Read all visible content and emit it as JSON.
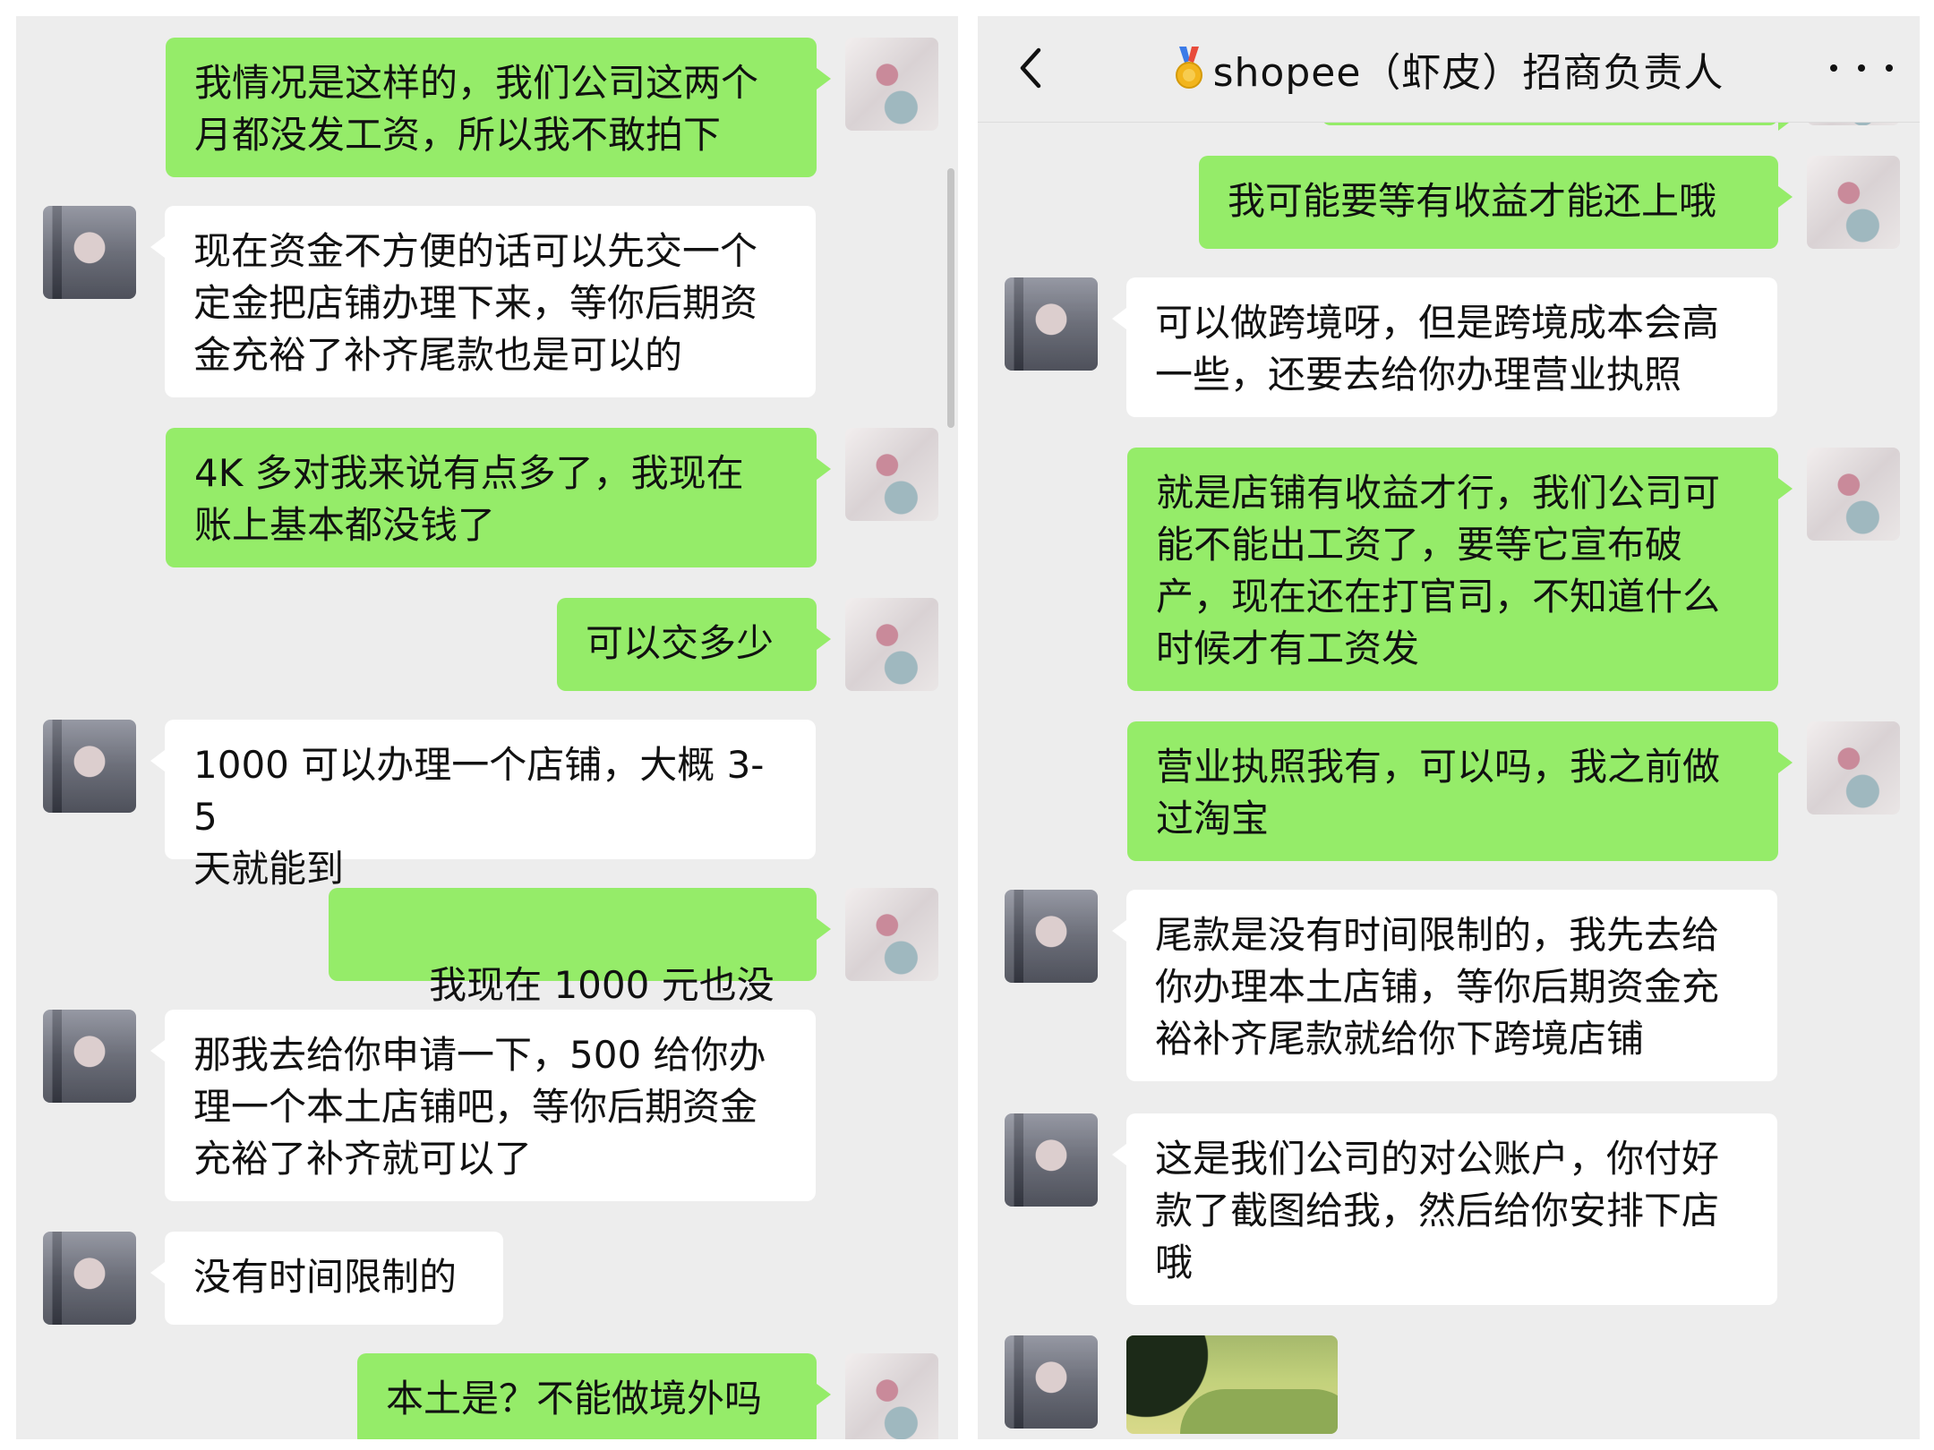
{
  "left_chat": {
    "messages": [
      {
        "side": "out",
        "text": "我情况是这样的，我们公司这两个\n月都没发工资，所以我不敢拍下"
      },
      {
        "side": "in",
        "text": "现在资金不方便的话可以先交一个\n定金把店铺办理下来，等你后期资\n金充裕了补齐尾款也是可以的"
      },
      {
        "side": "out",
        "text": "4K 多对我来说有点多了，我现在\n账上基本都没钱了"
      },
      {
        "side": "out",
        "text": "可以交多少"
      },
      {
        "side": "in",
        "text": "1000 可以办理一个店铺，大概 3-5\n天就能到"
      },
      {
        "side": "out",
        "text": "我现在 1000 元也没有",
        "emoji": "😭"
      },
      {
        "side": "in",
        "text": "那我去给你申请一下，500 给你办\n理一个本土店铺吧，等你后期资金\n充裕了补齐就可以了"
      },
      {
        "side": "in",
        "text": "没有时间限制的"
      },
      {
        "side": "out",
        "text": "本土是？不能做境外吗"
      }
    ]
  },
  "right_chat": {
    "header": {
      "title": "shopee（虾皮）招商负责人"
    },
    "messages": [
      {
        "side": "out",
        "text": "我可能要等有收益才能还上哦"
      },
      {
        "side": "in",
        "text": "可以做跨境呀，但是跨境成本会高\n一些，还要去给你办理营业执照"
      },
      {
        "side": "out",
        "text": "就是店铺有收益才行，我们公司可\n能不能出工资了，要等它宣布破\n产，现在还在打官司，不知道什么\n时候才有工资发"
      },
      {
        "side": "out",
        "text": "营业执照我有，可以吗，我之前做\n过淘宝"
      },
      {
        "side": "in",
        "text": "尾款是没有时间限制的，我先去给\n你办理本土店铺，等你后期资金充\n裕补齐尾款就给你下跨境店铺"
      },
      {
        "side": "in",
        "text": "这是我们公司的对公账户，你付好\n款了截图给我，然后给你安排下店\n哦"
      }
    ]
  },
  "colors": {
    "chat_background": "#ededed",
    "outgoing_bubble": "#95ec69",
    "incoming_bubble": "#ffffff"
  },
  "icons": {
    "back": "chevron-left-icon",
    "more": "more-dots-icon",
    "title_badge": "medal-icon"
  }
}
